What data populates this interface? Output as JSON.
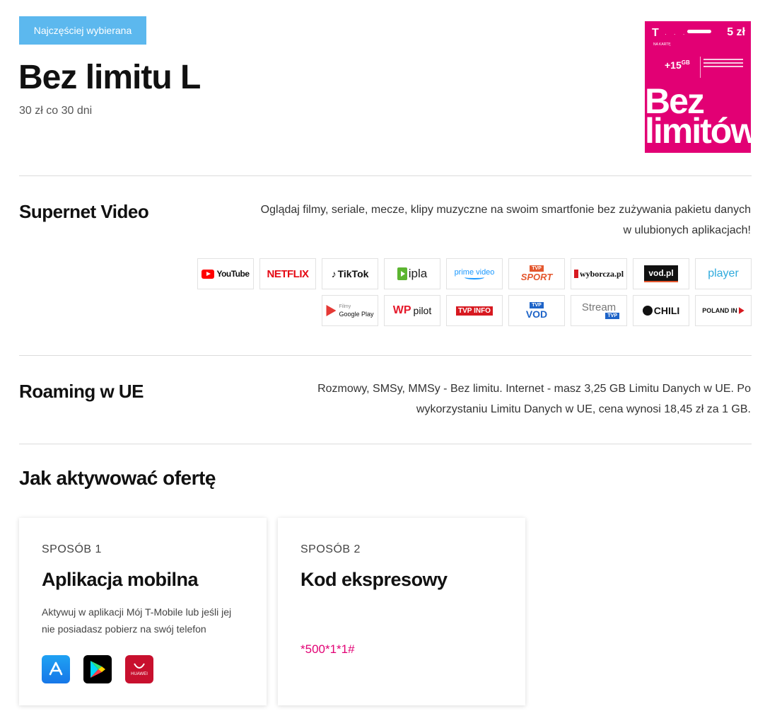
{
  "header": {
    "badge": "Najczęściej wybierana",
    "title": "Bez limitu L",
    "price": "30 zł co 30 dni"
  },
  "card_image": {
    "brand": "T",
    "subtitle": "NA KARTĘ",
    "price": "5 zł",
    "bonus": "+15",
    "bonus_unit": "GB",
    "big_text_line1": "Bez",
    "big_text_line2": "limitów",
    "brand_color": "#e20074"
  },
  "supernet": {
    "heading": "Supernet Video",
    "text_line1": "Oglądaj filmy, seriale, mecze, klipy muzyczne na swoim smartfonie bez zużywania pakietu danych",
    "text_line2": "w ulubionych aplikacjach!",
    "apps_row1": [
      "YouTube",
      "NETFLIX",
      "TikTok",
      "ipla",
      "prime video",
      "SPORT",
      "wyborcza.pl",
      "vod.pl",
      "player"
    ],
    "apps_row2": [
      "Google Play",
      "pilot",
      "TVP INFO",
      "VOD",
      "Stream",
      "CHILI",
      "POLAND IN"
    ]
  },
  "roaming": {
    "heading": "Roaming w UE",
    "text_line1": "Rozmowy, SMSy, MMSy - Bez limitu. Internet - masz 3,25 GB Limitu Danych w UE. Po",
    "text_line2": "wykorzystaniu Limitu Danych w UE, cena wynosi 18,45 zł za 1 GB."
  },
  "activation": {
    "heading": "Jak aktywować ofertę",
    "method1": {
      "label": "SPOSÓB 1",
      "title": "Aplikacja mobilna",
      "desc_line1": "Aktywuj w aplikacji Mój T-Mobile lub jeśli jej",
      "desc_line2": "nie posiadasz pobierz na swój telefon",
      "stores": [
        "app-store-icon",
        "google-play-icon",
        "huawei-appgallery-icon"
      ]
    },
    "method2": {
      "label": "SPOSÓB 2",
      "title": "Kod ekspresowy",
      "code": "*500*1*1#"
    }
  },
  "colors": {
    "badge": "#5cb8ee",
    "magenta": "#e20074",
    "divider": "#dcdcdc"
  }
}
